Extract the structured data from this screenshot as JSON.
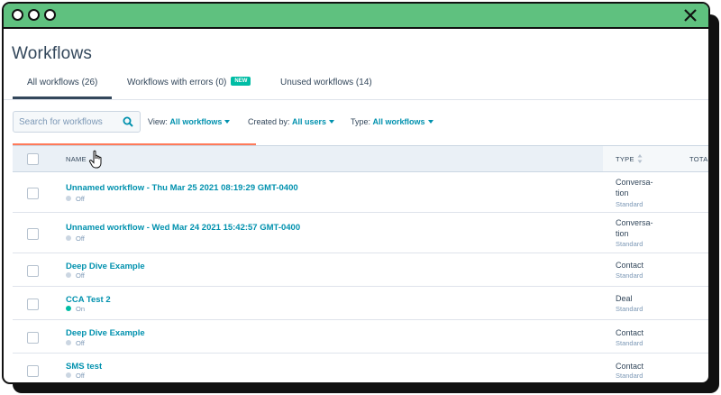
{
  "page": {
    "title": "Workflows"
  },
  "tabs": [
    {
      "label": "All workflows (26)"
    },
    {
      "label": "Workflows with errors (0)",
      "badge": "NEW"
    },
    {
      "label": "Unused workflows (14)"
    }
  ],
  "search": {
    "placeholder": "Search for workflows"
  },
  "filters": {
    "view": {
      "label": "View:",
      "value": "All workflows"
    },
    "created_by": {
      "label": "Created by:",
      "value": "All users"
    },
    "type": {
      "label": "Type:",
      "value": "All workflows"
    }
  },
  "loading_progress": 0.35,
  "table": {
    "columns": {
      "name": "NAME",
      "type": "TYPE",
      "total": "TOTAL"
    },
    "rows": [
      {
        "name": "Unnamed workflow - Thu Mar 25 2021 08:19:29 GMT-0400",
        "status": "Off",
        "type_line1": "Conversa-",
        "type_line2": "tion",
        "type_sub": "Standard"
      },
      {
        "name": "Unnamed workflow - Wed Mar 24 2021 15:42:57 GMT-0400",
        "status": "Off",
        "type_line1": "Conversa-",
        "type_line2": "tion",
        "type_sub": "Standard"
      },
      {
        "name": "Deep Dive Example",
        "status": "Off",
        "type_line1": "Contact",
        "type_sub": "Standard"
      },
      {
        "name": "CCA Test 2",
        "status": "On",
        "type_line1": "Deal",
        "type_sub": "Standard"
      },
      {
        "name": "Deep Dive Example",
        "status": "Off",
        "type_line1": "Contact",
        "type_sub": "Standard"
      },
      {
        "name": "SMS test",
        "status": "Off",
        "type_line1": "Contact",
        "type_sub": "Standard"
      }
    ]
  },
  "colors": {
    "titlebar": "#5fc17f",
    "link": "#0091ae",
    "status_on": "#00bda5",
    "status_off": "#cbd6e2",
    "progress": "#ff7a59",
    "badge": "#00bda5"
  }
}
